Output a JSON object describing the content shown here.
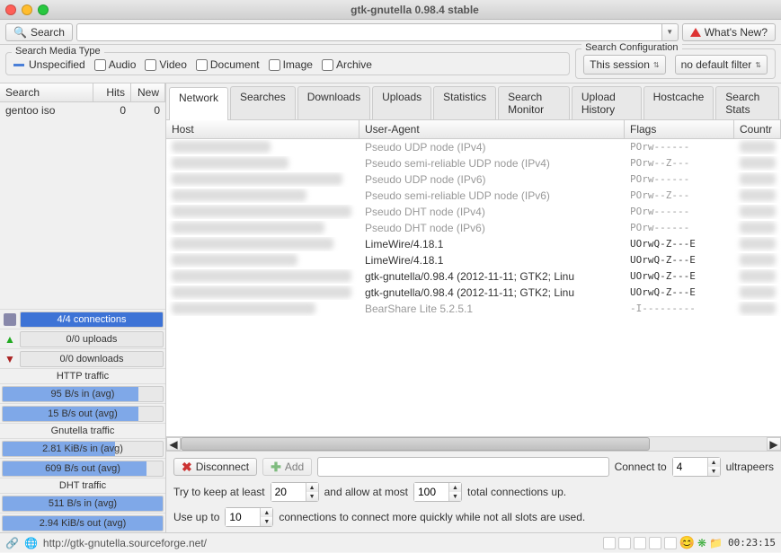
{
  "window": {
    "title": "gtk-gnutella 0.98.4 stable"
  },
  "toolbar": {
    "search_btn": "Search",
    "search_value": "",
    "whats_new": "What's New?"
  },
  "media_type": {
    "title": "Search Media Type",
    "unspecified": "Unspecified",
    "audio": "Audio",
    "video": "Video",
    "document": "Document",
    "image": "Image",
    "archive": "Archive"
  },
  "search_config": {
    "title": "Search Configuration",
    "session": "This session",
    "filter": "no default filter"
  },
  "left": {
    "hdr_search": "Search",
    "hdr_hits": "Hits",
    "hdr_new": "New",
    "rows": [
      {
        "name": "gentoo iso",
        "hits": "0",
        "new": "0"
      }
    ],
    "stats": {
      "connections": "4/4 connections",
      "uploads": "0/0 uploads",
      "downloads": "0/0 downloads",
      "http_title": "HTTP traffic",
      "http_in": "95 B/s in (avg)",
      "http_out": "15 B/s out (avg)",
      "gnutella_title": "Gnutella traffic",
      "gnutella_in": "2.81 KiB/s in (avg)",
      "gnutella_out": "609 B/s out (avg)",
      "dht_title": "DHT traffic",
      "dht_in": "511 B/s in (avg)",
      "dht_out": "2.94 KiB/s out (avg)"
    }
  },
  "tabs": [
    "Network",
    "Searches",
    "Downloads",
    "Uploads",
    "Statistics",
    "Search Monitor",
    "Upload History",
    "Hostcache",
    "Search Stats"
  ],
  "net_hdr": {
    "host": "Host",
    "ua": "User-Agent",
    "flags": "Flags",
    "country": "Countr"
  },
  "net_rows": [
    {
      "dim": true,
      "ua": "Pseudo UDP node (IPv4)",
      "flags": "POrw------"
    },
    {
      "dim": true,
      "ua": "Pseudo semi-reliable UDP node (IPv4)",
      "flags": "POrw--Z---"
    },
    {
      "dim": true,
      "ua": "Pseudo UDP node (IPv6)",
      "flags": "POrw------"
    },
    {
      "dim": true,
      "ua": "Pseudo semi-reliable UDP node (IPv6)",
      "flags": "POrw--Z---"
    },
    {
      "dim": true,
      "ua": "Pseudo DHT node (IPv4)",
      "flags": "POrw------"
    },
    {
      "dim": true,
      "ua": "Pseudo DHT node (IPv6)",
      "flags": "POrw------"
    },
    {
      "dim": false,
      "ua": "LimeWire/4.18.1",
      "flags": "UOrwQ-Z---E"
    },
    {
      "dim": false,
      "ua": "LimeWire/4.18.1",
      "flags": "UOrwQ-Z---E"
    },
    {
      "dim": false,
      "ua": "gtk-gnutella/0.98.4 (2012-11-11; GTK2; Linu",
      "flags": "UOrwQ-Z---E"
    },
    {
      "dim": false,
      "ua": "gtk-gnutella/0.98.4 (2012-11-11; GTK2; Linu",
      "flags": "UOrwQ-Z---E"
    },
    {
      "dim": true,
      "ua": "BearShare Lite 5.2.5.1",
      "flags": "-I---------"
    }
  ],
  "controls": {
    "disconnect": "Disconnect",
    "add": "Add",
    "connect_to": "Connect to",
    "connect_n": "4",
    "ultrapeers": "ultrapeers",
    "keep_least": "Try to keep at least",
    "keep_n": "20",
    "allow_most": "and allow at most",
    "allow_n": "100",
    "total_up": "total connections up.",
    "use_up_to": "Use up to",
    "use_n": "10",
    "use_tail": "connections to connect more quickly while not all slots are used."
  },
  "status": {
    "url": "http://gtk-gnutella.sourceforge.net/",
    "clock": "00:23:15"
  }
}
